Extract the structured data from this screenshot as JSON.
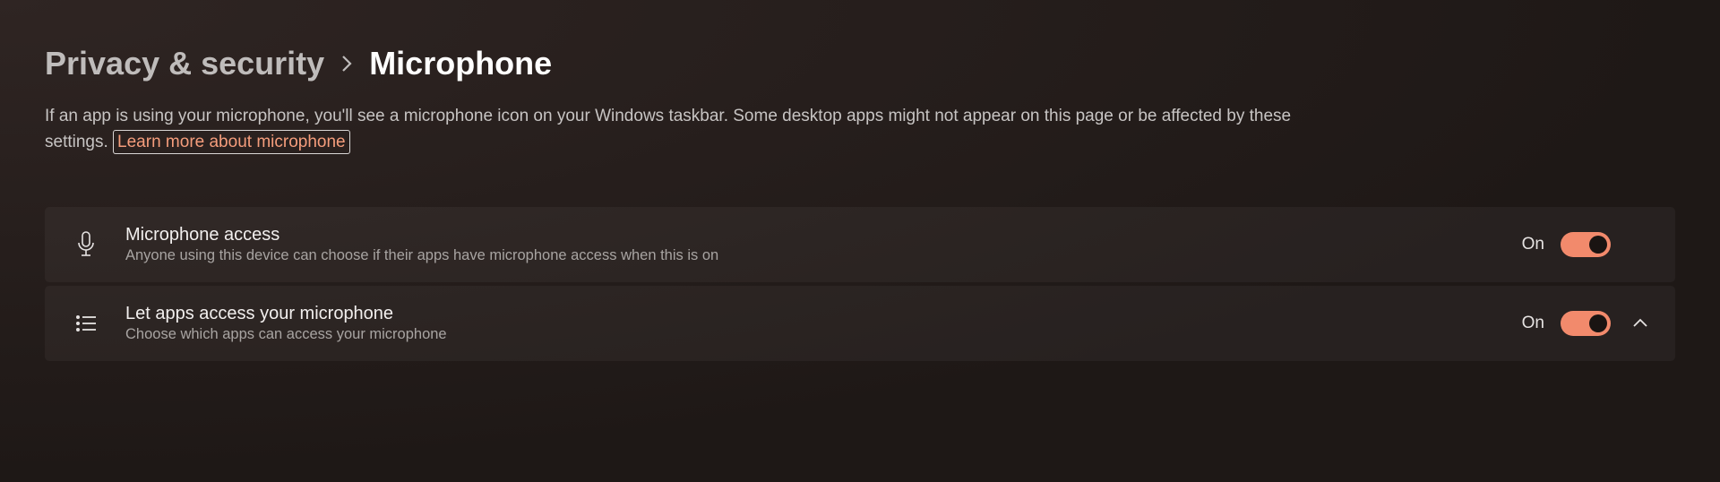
{
  "breadcrumb": {
    "parent": "Privacy & security",
    "current": "Microphone"
  },
  "description": "If an app is using your microphone, you'll see a microphone icon on your Windows taskbar. Some desktop apps might not appear on this page or be affected by these settings. ",
  "learn_link": "Learn more about microphone",
  "rows": [
    {
      "title": "Microphone access",
      "subtitle": "Anyone using this device can choose if their apps have microphone access when this is on",
      "state": "On"
    },
    {
      "title": "Let apps access your microphone",
      "subtitle": "Choose which apps can access your microphone",
      "state": "On"
    }
  ]
}
